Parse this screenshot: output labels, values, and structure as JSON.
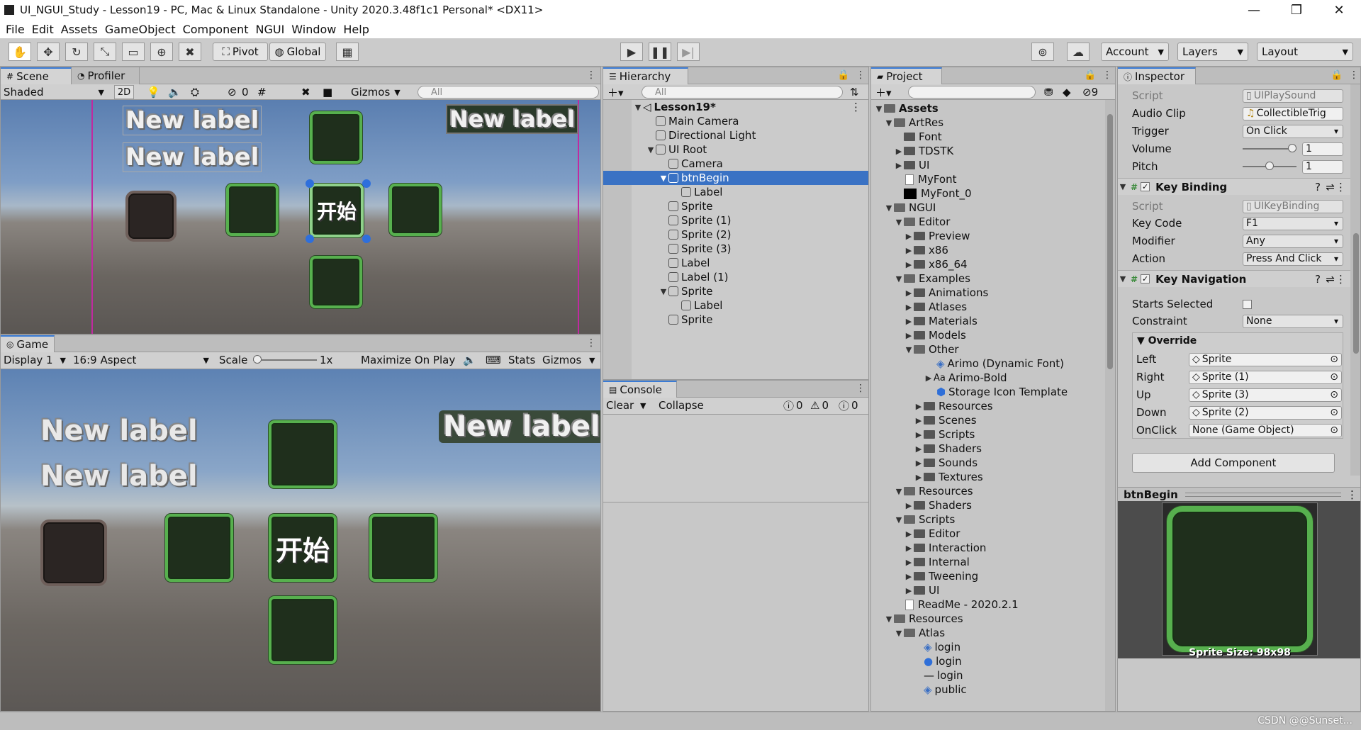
{
  "window": {
    "title": "UI_NGUI_Study - Lesson19 - PC, Mac & Linux Standalone - Unity 2020.3.48f1c1 Personal* <DX11>"
  },
  "menu": [
    "File",
    "Edit",
    "Assets",
    "GameObject",
    "Component",
    "NGUI",
    "Window",
    "Help"
  ],
  "toolbar": {
    "pivot": "Pivot",
    "global": "Global",
    "account": "Account",
    "layers": "Layers",
    "layout": "Layout"
  },
  "scene": {
    "tab_scene": "Scene",
    "tab_profiler": "Profiler",
    "shading": "Shaded",
    "mode2d": "2D",
    "hidden_count": "0",
    "gizmos": "Gizmos",
    "search_placeholder": "All",
    "label1": "New label",
    "label2": "New label",
    "label3": "New label",
    "start_text": "开始"
  },
  "game": {
    "tab": "Game",
    "display": "Display 1",
    "aspect": "16:9 Aspect",
    "scale_label": "Scale",
    "scale_value": "1x",
    "maximize": "Maximize On Play",
    "stats": "Stats",
    "gizmos": "Gizmos",
    "label1": "New label",
    "label2": "New label",
    "label3": "New label",
    "start_text": "开始"
  },
  "hierarchy": {
    "tab": "Hierarchy",
    "search_placeholder": "All",
    "scene_root": "Lesson19*",
    "items": [
      "Main Camera",
      "Directional Light",
      "UI Root",
      "Camera",
      "btnBegin",
      "Label",
      "Sprite",
      "Sprite (1)",
      "Sprite (2)",
      "Sprite (3)",
      "Label",
      "Label (1)",
      "Sprite",
      "Label",
      "Sprite"
    ]
  },
  "console": {
    "tab": "Console",
    "clear": "Clear",
    "collapse": "Collapse",
    "log_count": "0",
    "warn_count": "0",
    "error_count": "0"
  },
  "project": {
    "tab": "Project",
    "hidden_count": "9",
    "items": [
      "Assets",
      "ArtRes",
      "Font",
      "TDSTK",
      "UI",
      "MyFont",
      "MyFont_0",
      "NGUI",
      "Editor",
      "Preview",
      "x86",
      "x86_64",
      "Examples",
      "Animations",
      "Atlases",
      "Materials",
      "Models",
      "Other",
      "Arimo (Dynamic Font)",
      "Arimo-Bold",
      "Storage Icon Template",
      "Resources",
      "Scenes",
      "Scripts",
      "Shaders",
      "Sounds",
      "Textures",
      "Resources",
      "Shaders",
      "Scripts",
      "Editor",
      "Interaction",
      "Internal",
      "Tweening",
      "UI",
      "ReadMe - 2020.2.1",
      "Resources",
      "Atlas",
      "login",
      "login",
      "login",
      "public"
    ]
  },
  "inspector": {
    "tab": "Inspector",
    "play_sound": {
      "script_label": "Script",
      "script_value": "UIPlaySound",
      "audio_label": "Audio Clip",
      "audio_value": "CollectibleTrig",
      "trigger_label": "Trigger",
      "trigger_value": "On Click",
      "volume_label": "Volume",
      "volume_value": "1",
      "volume_level": 1.0,
      "pitch_label": "Pitch",
      "pitch_value": "1",
      "pitch_level": 0.5
    },
    "key_binding": {
      "title": "Key Binding",
      "script_label": "Script",
      "script_value": "UIKeyBinding",
      "keycode_label": "Key Code",
      "keycode_value": "F1",
      "modifier_label": "Modifier",
      "modifier_value": "Any",
      "action_label": "Action",
      "action_value": "Press And Click"
    },
    "key_navigation": {
      "title": "Key Navigation",
      "starts_label": "Starts Selected",
      "constraint_label": "Constraint",
      "constraint_value": "None",
      "override_label": "Override",
      "left_label": "Left",
      "left_value": "Sprite",
      "right_label": "Right",
      "right_value": "Sprite (1)",
      "up_label": "Up",
      "up_value": "Sprite (3)",
      "down_label": "Down",
      "down_value": "Sprite (2)",
      "onclick_label": "OnClick",
      "onclick_value": "None (Game Object)"
    },
    "add_component": "Add Component",
    "preview_title": "btnBegin",
    "sprite_size": "Sprite Size: 98x98"
  },
  "watermark": "CSDN @@Sunset..."
}
